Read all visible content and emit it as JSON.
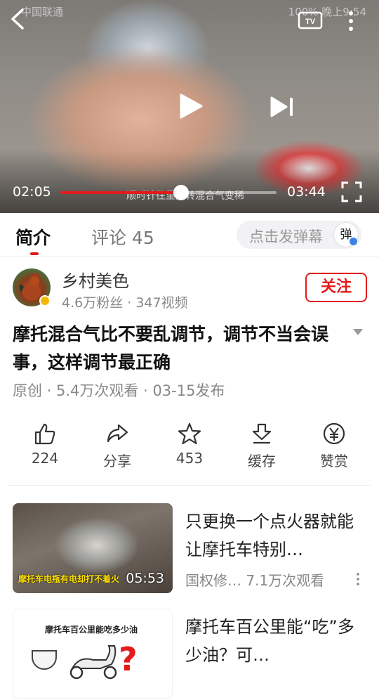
{
  "status_bar": {
    "carrier": "中国联通",
    "right": "100% 晚上9:54"
  },
  "player": {
    "current_time": "02:05",
    "total_time": "03:44",
    "progress": 0.56,
    "subtitle": "顺时针往里是转混合气变稀",
    "icons": [
      "back-icon",
      "tv-icon",
      "more-vertical-icon",
      "play-icon",
      "next-icon",
      "fullscreen-icon"
    ]
  },
  "tabs": {
    "intro": "简介",
    "comments": "评论 45"
  },
  "danmu": {
    "placeholder": "点击发弹幕",
    "button": "弹"
  },
  "author": {
    "name": "乡村美色",
    "meta": "4.6万粉丝 · 347视频",
    "follow": "关注"
  },
  "video": {
    "title": "摩托混合气比不要乱调节，调节不当会误事，这样调节最正确",
    "meta": "原创 · 5.4万次观看 · 03-15发布"
  },
  "actions": [
    {
      "icon": "thumbs-up-icon",
      "label": "224"
    },
    {
      "icon": "share-icon",
      "label": "分享"
    },
    {
      "icon": "star-icon",
      "label": "453"
    },
    {
      "icon": "download-icon",
      "label": "缓存"
    },
    {
      "icon": "yuan-icon",
      "label": "赞赏"
    }
  ],
  "recommendations": [
    {
      "title": "只更换一个点火器就能让摩托车特别…",
      "meta": "国权修… 7.1万次观看",
      "duration": "05:53",
      "thumb_caption": "摩托车电瓶有电却打不着火"
    },
    {
      "title": "摩托车百公里能“吃”多少油？可…",
      "thumb_caption": "摩托车百公里能吃多少油"
    }
  ],
  "colors": {
    "accent": "#e31b1b",
    "text": "#222222",
    "muted": "#888888"
  }
}
